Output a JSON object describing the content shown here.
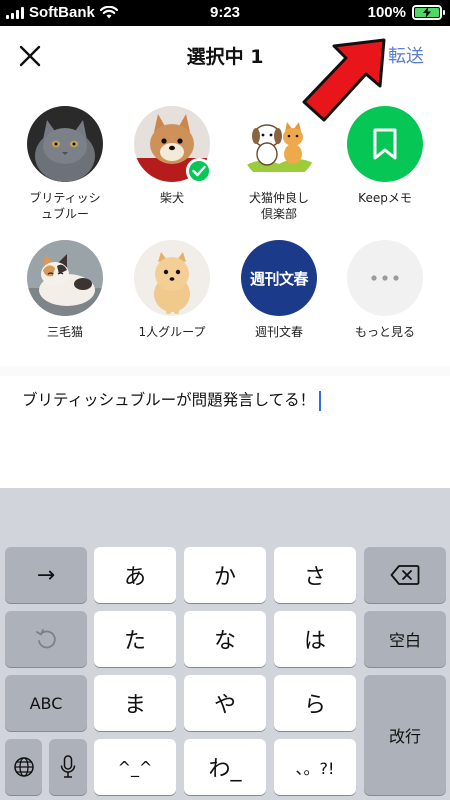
{
  "status_bar": {
    "carrier": "SoftBank",
    "time": "9:23",
    "battery_percent": "100%",
    "battery_level": 1.0
  },
  "header": {
    "title": "選択中 1",
    "forward_label": "転送",
    "close_icon": "close-icon"
  },
  "recipients": [
    {
      "label_line1": "ブリティッシ",
      "label_line2": "ュブルー",
      "avatar": "gray-cat-photo",
      "selected": false
    },
    {
      "label_line1": "柴犬",
      "label_line2": "",
      "avatar": "shiba-dog-photo",
      "selected": true
    },
    {
      "label_line1": "犬猫仲良し",
      "label_line2": "倶楽部",
      "avatar": "dog-cat-illustration",
      "selected": false
    },
    {
      "label_line1": "Keepメモ",
      "label_line2": "",
      "avatar": "bookmark-icon",
      "selected": false
    },
    {
      "label_line1": "三毛猫",
      "label_line2": "",
      "avatar": "calico-cat-photo",
      "selected": false
    },
    {
      "label_line1": "1人グループ",
      "label_line2": "",
      "avatar": "pomeranian-photo",
      "selected": false
    },
    {
      "label_line1": "週刊文春",
      "label_line2": "",
      "avatar_text": "週刊文春",
      "selected": false
    },
    {
      "label_line1": "もっと見る",
      "label_line2": "",
      "avatar": "more-icon",
      "selected": false
    }
  ],
  "message": {
    "text": "ブリティッシュブルーが問題発言してる！"
  },
  "keyboard": {
    "arrow": "→",
    "undo_icon": "undo-icon",
    "abc": "ABC",
    "globe_icon": "globe-icon",
    "mic_icon": "microphone-icon",
    "a": "あ",
    "ka": "か",
    "sa": "さ",
    "ta": "た",
    "na": "な",
    "ha": "は",
    "ma": "ま",
    "ya": "や",
    "ra": "ら",
    "emoticon": "^_^",
    "wa": "わ_",
    "punct": "、。?!",
    "delete_icon": "delete-icon",
    "space": "空白",
    "enter": "改行"
  },
  "colors": {
    "accent_blue": "#5b7fcf",
    "line_green": "#06c755",
    "arrow_red": "#e8151b",
    "keyboard_bg": "#d1d4da",
    "bunshun_navy": "#1b3a8a"
  }
}
